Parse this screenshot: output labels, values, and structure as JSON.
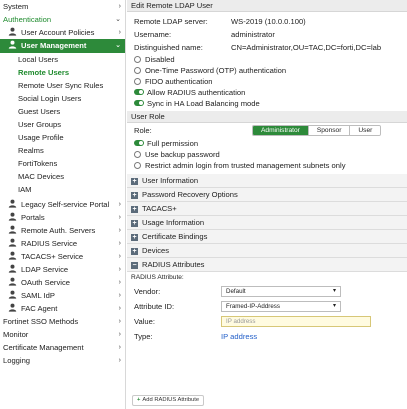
{
  "sidebar": {
    "items": [
      {
        "label": "System",
        "level": 0,
        "chevron": ">",
        "icon": "",
        "state": ""
      },
      {
        "label": "Authentication",
        "level": 0,
        "chevron": "v",
        "icon": "",
        "state": "section"
      },
      {
        "label": "User Account Policies",
        "level": 1,
        "chevron": ">",
        "icon": "user-lock-icon",
        "state": ""
      },
      {
        "label": "User Management",
        "level": 1,
        "chevron": "v",
        "icon": "users-icon",
        "state": "active"
      },
      {
        "label": "Local Users",
        "level": 2,
        "chevron": "",
        "icon": "",
        "state": ""
      },
      {
        "label": "Remote Users",
        "level": 2,
        "chevron": "",
        "icon": "",
        "state": "sub-active"
      },
      {
        "label": "Remote User Sync Rules",
        "level": 2,
        "chevron": "",
        "icon": "",
        "state": ""
      },
      {
        "label": "Social Login Users",
        "level": 2,
        "chevron": "",
        "icon": "",
        "state": ""
      },
      {
        "label": "Guest Users",
        "level": 2,
        "chevron": "",
        "icon": "",
        "state": ""
      },
      {
        "label": "User Groups",
        "level": 2,
        "chevron": "",
        "icon": "",
        "state": ""
      },
      {
        "label": "Usage Profile",
        "level": 2,
        "chevron": "",
        "icon": "",
        "state": ""
      },
      {
        "label": "Realms",
        "level": 2,
        "chevron": "",
        "icon": "",
        "state": ""
      },
      {
        "label": "FortiTokens",
        "level": 2,
        "chevron": "",
        "icon": "",
        "state": ""
      },
      {
        "label": "MAC Devices",
        "level": 2,
        "chevron": "",
        "icon": "",
        "state": ""
      },
      {
        "label": "IAM",
        "level": 2,
        "chevron": "",
        "icon": "",
        "state": ""
      },
      {
        "label": "Legacy Self-service Portal",
        "level": 1,
        "chevron": ">",
        "icon": "user-portal-icon",
        "state": "gap"
      },
      {
        "label": "Portals",
        "level": 1,
        "chevron": ">",
        "icon": "portal-icon",
        "state": ""
      },
      {
        "label": "Remote Auth. Servers",
        "level": 1,
        "chevron": ">",
        "icon": "server-icon",
        "state": ""
      },
      {
        "label": "RADIUS Service",
        "level": 1,
        "chevron": ">",
        "icon": "radius-icon",
        "state": ""
      },
      {
        "label": "TACACS+ Service",
        "level": 1,
        "chevron": ">",
        "icon": "tacacs-icon",
        "state": ""
      },
      {
        "label": "LDAP Service",
        "level": 1,
        "chevron": ">",
        "icon": "ldap-icon",
        "state": ""
      },
      {
        "label": "OAuth Service",
        "level": 1,
        "chevron": ">",
        "icon": "oauth-icon",
        "state": ""
      },
      {
        "label": "SAML IdP",
        "level": 1,
        "chevron": ">",
        "icon": "saml-icon",
        "state": ""
      },
      {
        "label": "FAC Agent",
        "level": 1,
        "chevron": ">",
        "icon": "agent-icon",
        "state": ""
      },
      {
        "label": "Fortinet SSO Methods",
        "level": 0,
        "chevron": ">",
        "icon": "",
        "state": ""
      },
      {
        "label": "Monitor",
        "level": 0,
        "chevron": ">",
        "icon": "",
        "state": ""
      },
      {
        "label": "Certificate Management",
        "level": 0,
        "chevron": ">",
        "icon": "",
        "state": ""
      },
      {
        "label": "Logging",
        "level": 0,
        "chevron": ">",
        "icon": "",
        "state": ""
      }
    ]
  },
  "main": {
    "header": "Edit Remote LDAP User",
    "fields": [
      {
        "key": "Remote LDAP server:",
        "value": "WS-2019 (10.0.0.100)"
      },
      {
        "key": "Username:",
        "value": "administrator"
      },
      {
        "key": "Distinguished name:",
        "value": "CN=Administrator,OU=TAC,DC=forti,DC=lab"
      }
    ],
    "options": [
      {
        "label": "Disabled",
        "type": "radio",
        "on": false
      },
      {
        "label": "One-Time Password (OTP) authentication",
        "type": "radio",
        "on": false
      },
      {
        "label": "FIDO authentication",
        "type": "radio",
        "on": false
      },
      {
        "label": "Allow RADIUS authentication",
        "type": "toggle",
        "on": true
      },
      {
        "label": "Sync in HA Load Balancing mode",
        "type": "toggle",
        "on": true
      }
    ],
    "user_role": {
      "header": "User Role",
      "role_label": "Role:",
      "roles": [
        "Administrator",
        "Sponsor",
        "User"
      ],
      "selected": "Administrator",
      "options": [
        {
          "label": "Full permission",
          "type": "toggle",
          "on": true
        },
        {
          "label": "Use backup password",
          "type": "radio",
          "on": false
        },
        {
          "label": "Restrict admin login from trusted management subnets only",
          "type": "radio",
          "on": false
        }
      ]
    },
    "sections": [
      {
        "label": "User Information",
        "icon": "+"
      },
      {
        "label": "Password Recovery Options",
        "icon": "+"
      },
      {
        "label": "TACACS+",
        "icon": "+"
      },
      {
        "label": "Usage Information",
        "icon": "+"
      },
      {
        "label": "Certificate Bindings",
        "icon": "+"
      },
      {
        "label": "Devices",
        "icon": "+"
      }
    ],
    "radius": {
      "header": "RADIUS Attributes",
      "icon": "−",
      "subtitle": "RADIUS Attribute:",
      "vendor_label": "Vendor:",
      "vendor_value": "Default",
      "attr_label": "Attribute ID:",
      "attr_value": "Framed-IP-Address",
      "value_label": "Value:",
      "value_placeholder": "IP address",
      "type_label": "Type:",
      "type_value": "IP address",
      "add_button": "Add RADIUS Attribute"
    }
  },
  "colors": {
    "accent": "#2d8a3a",
    "link": "#2460c9"
  }
}
